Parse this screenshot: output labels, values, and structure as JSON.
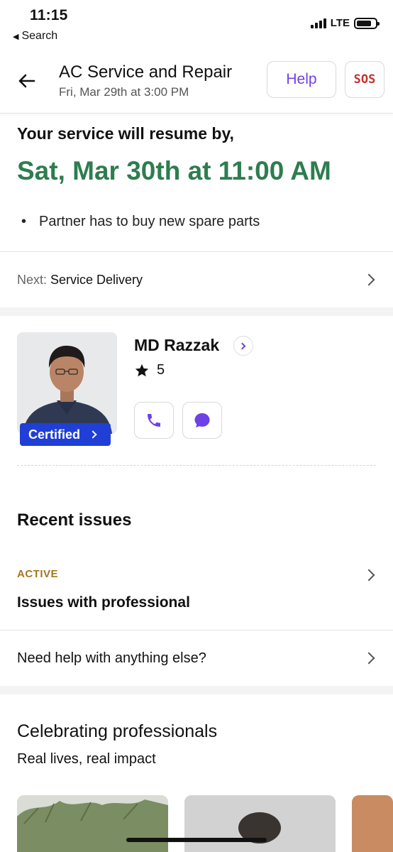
{
  "status_bar": {
    "time": "11:15",
    "back_app_label": "Search",
    "network": "LTE",
    "battery_level": 0.8
  },
  "header": {
    "back_icon": "arrow-left-icon",
    "title": "AC Service and Repair",
    "subtitle": "Fri, Mar 29th at 3:00 PM",
    "help_label": "Help",
    "sos_label": "SOS"
  },
  "resume": {
    "label": "Your service will resume by,",
    "date": "Sat, Mar 30th at 11:00 AM",
    "reason_bullet": "•",
    "reason": "Partner has to buy new spare parts"
  },
  "next_step": {
    "key": "Next:",
    "value": "Service Delivery"
  },
  "partner": {
    "name": "MD Razzak",
    "rating": "5",
    "badge": "Certified",
    "call_icon": "phone-icon",
    "chat_icon": "chat-icon"
  },
  "recent_issues": {
    "title": "Recent issues",
    "items": [
      {
        "status": "ACTIVE",
        "title": "Issues with professional"
      }
    ],
    "help_row": "Need help with anything else?"
  },
  "celebrating": {
    "title": "Celebrating professionals",
    "subtitle": "Real lives, real impact"
  },
  "colors": {
    "accent": "#6e42e5",
    "resume_green": "#2e7d4f",
    "sos_red": "#c9302c",
    "certified_blue": "#1f3fd6",
    "active_gold": "#a6761d"
  }
}
